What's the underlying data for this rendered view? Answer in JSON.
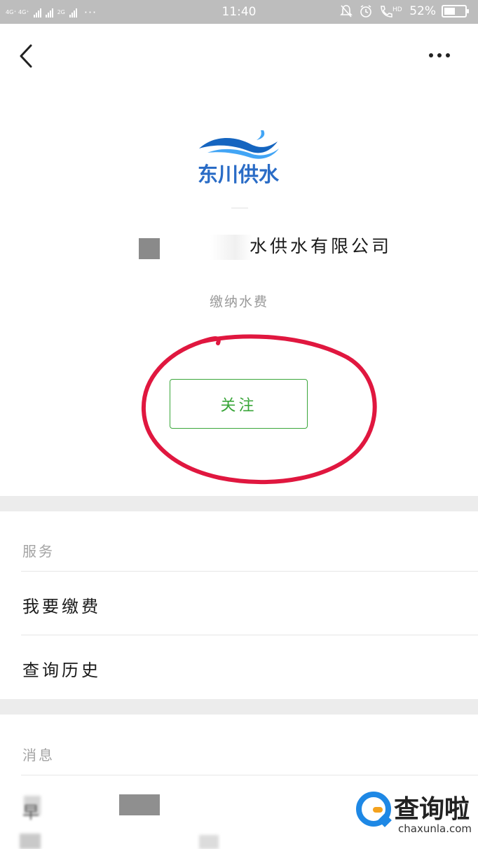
{
  "status_bar": {
    "network_left": "4G⁺ 4G⁺",
    "network_right": "2G",
    "time": "11:40",
    "hd_label": "HD",
    "battery_percent": "52%",
    "battery_level": 0.52
  },
  "header": {
    "back_icon": "chevron-left-icon",
    "more_icon": "more-horizontal-icon"
  },
  "account": {
    "logo_text": "东川供水",
    "name": "水供水有限公司",
    "description": "缴纳水费",
    "follow_label": "关注",
    "brand_color": "#2a6cc6",
    "follow_color": "#3aa63a",
    "annotation_color": "#e0173f"
  },
  "services": {
    "title": "服务",
    "items": [
      {
        "label": "我要缴费"
      },
      {
        "label": "查询历史"
      }
    ]
  },
  "messages": {
    "title": "消息",
    "first_char": "早"
  },
  "watermark": {
    "title": "查询啦",
    "domain": "chaxunla.com"
  }
}
